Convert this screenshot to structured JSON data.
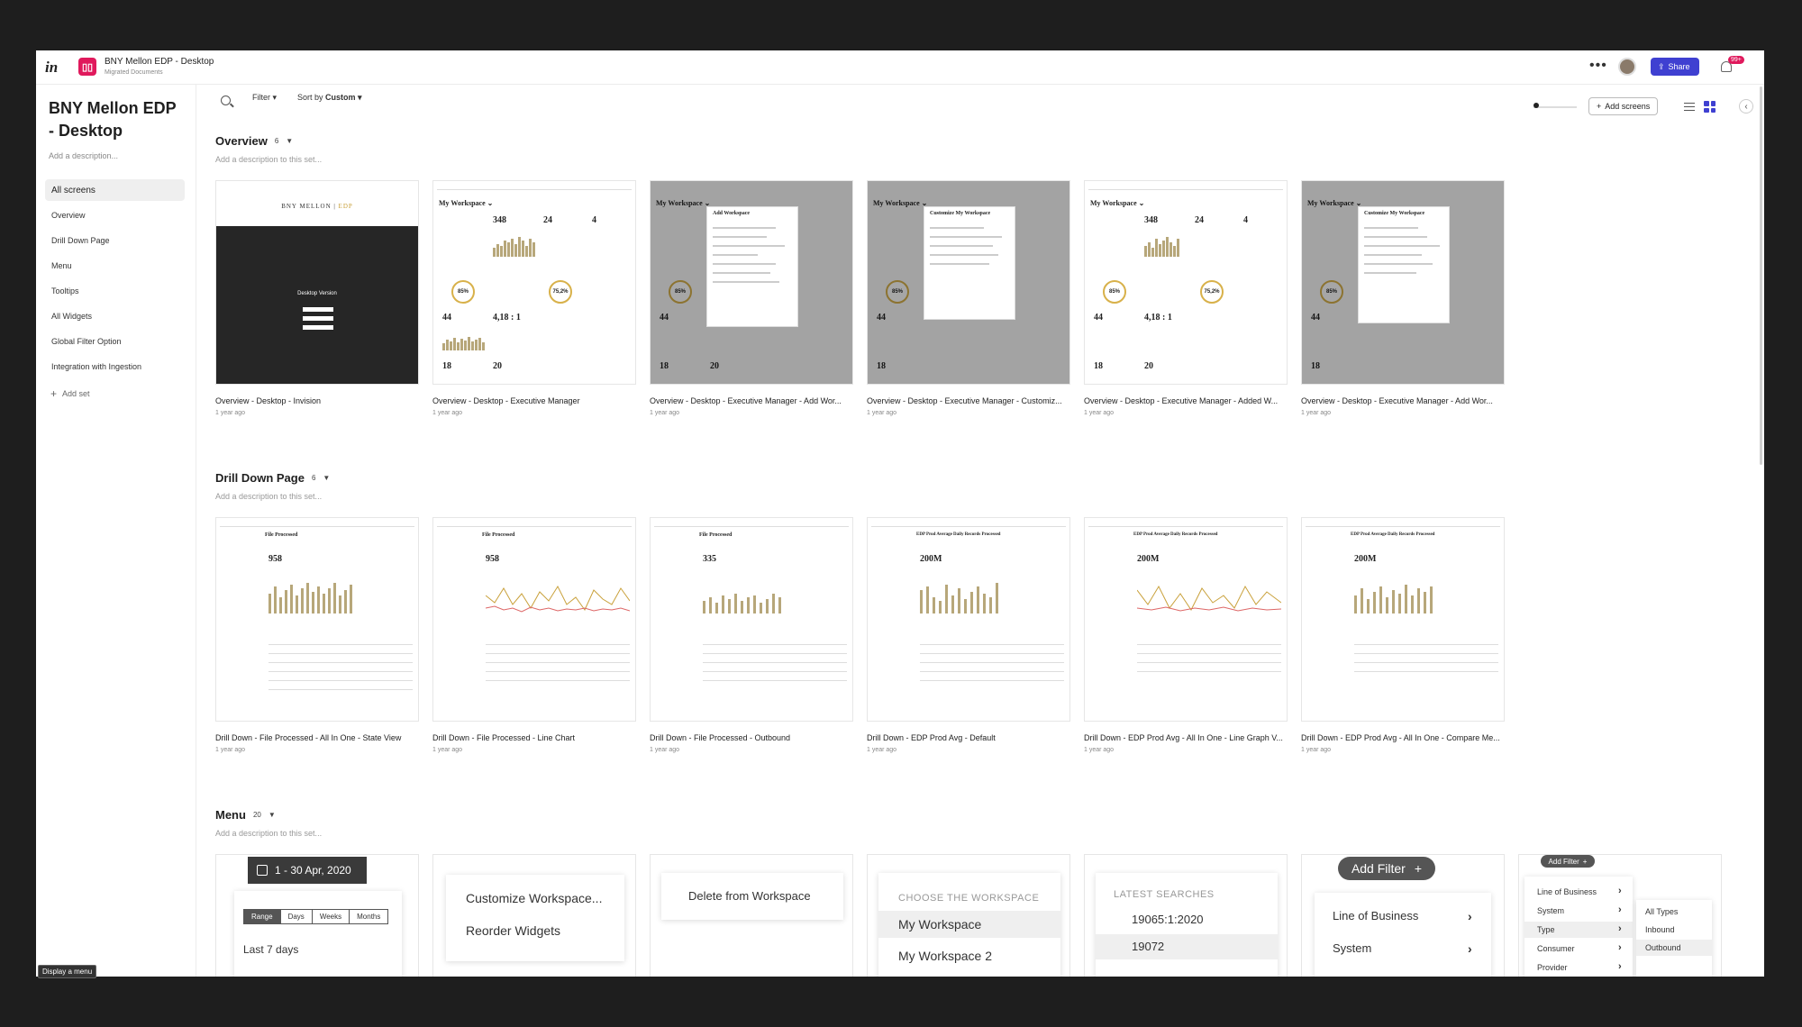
{
  "topbar": {
    "logo": "in",
    "project_title": "BNY Mellon EDP - Desktop",
    "project_subtitle": "Migrated Documents",
    "more": "•••",
    "share_label": "Share",
    "notifications": "99+"
  },
  "sidebar": {
    "title": "BNY Mellon EDP - Desktop",
    "description": "Add a description...",
    "items": [
      {
        "label": "All screens"
      },
      {
        "label": "Overview"
      },
      {
        "label": "Drill Down Page"
      },
      {
        "label": "Menu"
      },
      {
        "label": "Tooltips"
      },
      {
        "label": "All Widgets"
      },
      {
        "label": "Global Filter Option"
      },
      {
        "label": "Integration with Ingestion"
      }
    ],
    "add_set": "Add set"
  },
  "toolbar": {
    "filter_label": "Filter ▾",
    "sort_prefix": "Sort by",
    "sort_value": "Custom ▾",
    "add_screens": "Add screens"
  },
  "sections": [
    {
      "title": "Overview",
      "count": "6",
      "description": "Add a description to this set...",
      "cards": [
        {
          "label": "Overview - Desktop - Invision",
          "time": "1 year ago"
        },
        {
          "label": "Overview - Desktop - Executive Manager",
          "time": "1 year ago"
        },
        {
          "label": "Overview - Desktop - Executive Manager - Add Wor...",
          "time": "1 year ago"
        },
        {
          "label": "Overview - Desktop - Executive Manager - Customiz...",
          "time": "1 year ago"
        },
        {
          "label": "Overview - Desktop - Executive Manager - Added W...",
          "time": "1 year ago"
        },
        {
          "label": "Overview - Desktop - Executive Manager - Add Wor...",
          "time": "1 year ago"
        }
      ]
    },
    {
      "title": "Drill Down Page",
      "count": "6",
      "description": "Add a description to this set...",
      "cards": [
        {
          "label": "Drill Down - File Processed - All In One - State View",
          "time": "1 year ago"
        },
        {
          "label": "Drill Down - File Processed - Line Chart",
          "time": "1 year ago"
        },
        {
          "label": "Drill Down - File Processed - Outbound",
          "time": "1 year ago"
        },
        {
          "label": "Drill Down - EDP Prod Avg - Default",
          "time": "1 year ago"
        },
        {
          "label": "Drill Down - EDP Prod Avg - All In One - Line Graph V...",
          "time": "1 year ago"
        },
        {
          "label": "Drill Down - EDP Prod Avg - All In One - Compare Me...",
          "time": "1 year ago"
        }
      ]
    },
    {
      "title": "Menu",
      "count": "20",
      "description": "Add a description to this set..."
    }
  ],
  "thumbs": {
    "invision_brand": "BNY MELLON",
    "invision_brand2": "EDP",
    "invision_title": "Desktop Version",
    "my_workspace": "My Workspace ⌄",
    "add_workspace": "Add Workspace",
    "customize_workspace": "Customize My Workspace",
    "file_processed": "File Processed",
    "edp_prod": "EDP Prod Average Daily Records Processed",
    "kpi_348": "348",
    "kpi_24": "24",
    "kpi_4": "4",
    "kpi_44": "44",
    "kpi_418": "4,18 : 1",
    "kpi_18": "18",
    "kpi_20": "20",
    "ring_85": "85%",
    "ring_752": "75,2%",
    "kpi_958": "958",
    "kpi_335": "335",
    "kpi_200m": "200M"
  },
  "menu_cards": {
    "date_range": "1 - 30 Apr, 2020",
    "seg_range": "Range",
    "seg_days": "Days",
    "seg_weeks": "Weeks",
    "seg_months": "Months",
    "last7": "Last 7 days",
    "customize": "Customize Workspace...",
    "reorder": "Reorder Widgets",
    "delete": "Delete from Workspace",
    "choose_caption": "CHOOSE THE WORKSPACE",
    "ws1": "My Workspace",
    "ws2": "My Workspace 2",
    "latest_caption": "LATEST SEARCHES",
    "search1": "19065:1:2020",
    "search2": "19072",
    "add_filter": "Add Filter",
    "lob": "Line of Business",
    "system": "System",
    "f_add_filter": "Add Filter",
    "f_lob": "Line of Business",
    "f_system": "System",
    "f_type": "Type",
    "f_consumer": "Consumer",
    "f_provider": "Provider",
    "f_all_types": "All Types",
    "f_inbound": "Inbound",
    "f_outbound": "Outbound"
  },
  "tooltip": "Display a menu",
  "colors": {
    "accent": "#3f40d1",
    "brand": "#e0195c",
    "gold": "#c9a13b"
  }
}
